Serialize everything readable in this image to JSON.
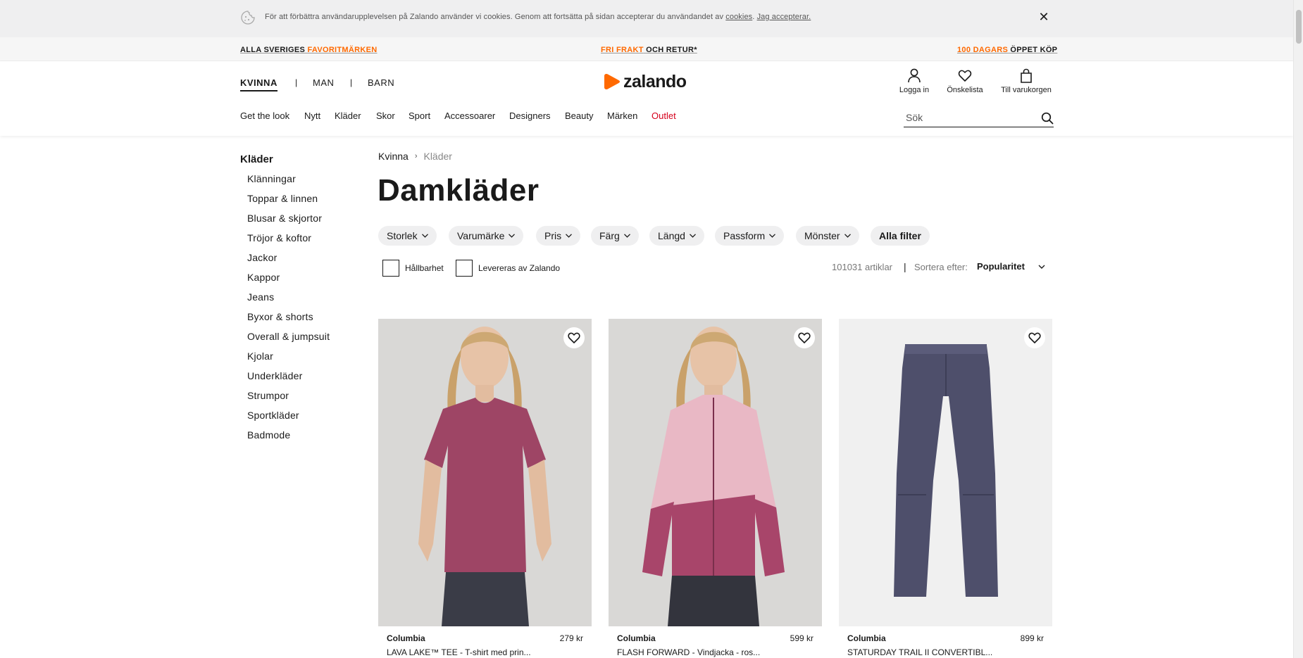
{
  "cookie": {
    "text": "För att förbättra användarupplevelsen på Zalando använder vi cookies. Genom att fortsätta på sidan accepterar du användandet av",
    "link": "cookies",
    "accept": "Jag accepterar.",
    "close_icon": "close-icon"
  },
  "promo": {
    "left_plain": "ALLA SVERIGES ",
    "left_accent": "FAVORITMÄRKEN",
    "center_accent": "FRI FRAKT",
    "center_plain": " OCH RETUR*",
    "right_accent": "100 DAGARS",
    "right_plain": " ÖPPET KÖP"
  },
  "header": {
    "genders": [
      "KVINNA",
      "MAN",
      "BARN"
    ],
    "gender_separator": "|",
    "logo_text": "zalando",
    "actions": {
      "login": "Logga in",
      "wishlist": "Önskelista",
      "cart": "Till varukorgen"
    },
    "categories": [
      "Get the look",
      "Nytt",
      "Kläder",
      "Skor",
      "Sport",
      "Accessoarer",
      "Designers",
      "Beauty",
      "Märken",
      "Outlet"
    ],
    "search_placeholder": "Sök",
    "accent_color": "#ff6900",
    "outlet_color": "#d6001c"
  },
  "sidebar": {
    "title": "Kläder",
    "items": [
      "Klänningar",
      "Toppar & linnen",
      "Blusar & skjortor",
      "Tröjor & koftor",
      "Jackor",
      "Kappor",
      "Jeans",
      "Byxor & shorts",
      "Overall & jumpsuit",
      "Kjolar",
      "Underkläder",
      "Strumpor",
      "Sportkläder",
      "Badmode"
    ]
  },
  "main": {
    "breadcrumb": [
      "Kvinna",
      "Kläder"
    ],
    "title": "Damkläder",
    "filters": [
      "Storlek",
      "Varumärke",
      "Pris",
      "Färg",
      "Längd",
      "Passform",
      "Mönster"
    ],
    "all_filters": "Alla filter",
    "checkboxes": [
      "Hållbarhet",
      "Levereras av Zalando"
    ],
    "count": "101031 artiklar",
    "count_separator": "|",
    "sort_label": "Sortera efter:",
    "sort_value": "Popularitet"
  },
  "products": [
    {
      "brand": "Columbia",
      "price": "279 kr",
      "name": "LAVA LAKE™ TEE - T-shirt med prin...",
      "color": "#9e4565"
    },
    {
      "brand": "Columbia",
      "price": "599 kr",
      "name": "FLASH FORWARD - Vindjacka - ros...",
      "color": "#e9b8c5"
    },
    {
      "brand": "Columbia",
      "price": "899 kr",
      "name": "STATURDAY TRAIL II CONVERTIBL...",
      "color": "#4e4f6b"
    }
  ]
}
